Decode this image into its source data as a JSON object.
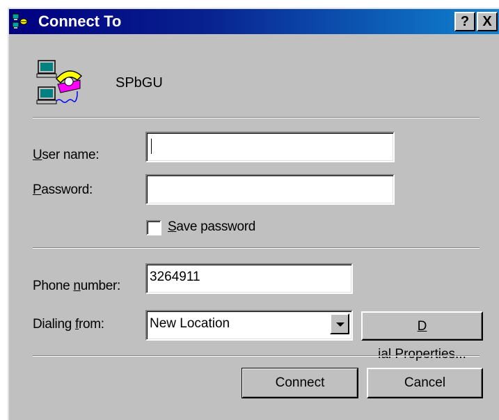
{
  "window": {
    "title": "Connect To",
    "help_glyph": "?",
    "close_glyph": "X"
  },
  "connection": {
    "name": "SPbGU",
    "icon": "dial-up-networking-icon"
  },
  "form": {
    "user_name": {
      "mnemonic": "U",
      "label_rest": "ser name:",
      "value": ""
    },
    "password": {
      "mnemonic": "P",
      "label_rest": "assword:",
      "value": ""
    },
    "save_password": {
      "mnemonic": "S",
      "label_rest": "ave password",
      "checked": false
    },
    "phone_number": {
      "label_pre": "Phone ",
      "mnemonic": "n",
      "label_rest": "umber:",
      "value": "3264911"
    },
    "dialing_from": {
      "label_pre": "Dialing ",
      "mnemonic": "f",
      "label_rest": "rom:",
      "value": "New Location"
    }
  },
  "buttons": {
    "dial_properties": {
      "mnemonic": "D",
      "label_rest": "ial Properties..."
    },
    "connect": "Connect",
    "cancel": "Cancel"
  },
  "colors": {
    "title_start": "#000080",
    "title_end": "#1084d0",
    "face": "#c0c0c0"
  }
}
